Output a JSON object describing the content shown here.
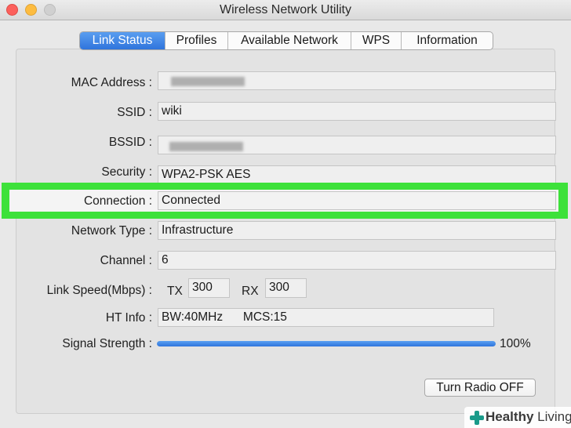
{
  "window": {
    "title": "Wireless Network Utility"
  },
  "tabs": [
    {
      "label": "Link Status",
      "active": true
    },
    {
      "label": "Profiles",
      "active": false
    },
    {
      "label": "Available Network",
      "active": false
    },
    {
      "label": "WPS",
      "active": false
    },
    {
      "label": "Information",
      "active": false
    }
  ],
  "fields": {
    "mac_address": {
      "label": "MAC Address :",
      "value": ""
    },
    "ssid": {
      "label": "SSID :",
      "value": "wiki"
    },
    "bssid": {
      "label": "BSSID :",
      "value": ""
    },
    "security": {
      "label": "Security :",
      "value": "WPA2-PSK AES"
    },
    "connection": {
      "label": "Connection :",
      "value": "Connected"
    },
    "network_type": {
      "label": "Network Type :",
      "value": "Infrastructure"
    },
    "channel": {
      "label": "Channel :",
      "value": "6"
    },
    "link_speed": {
      "label": "Link Speed(Mbps) :",
      "tx_label": "TX",
      "tx_value": "300",
      "rx_label": "RX",
      "rx_value": "300"
    },
    "ht_info": {
      "label": "HT Info :",
      "value": "BW:40MHz      MCS:15"
    },
    "signal_strength": {
      "label": "Signal Strength :",
      "value": "100%",
      "percent": 100
    }
  },
  "buttons": {
    "turn_radio_off": "Turn Radio OFF"
  },
  "highlight_color": "#3de13a",
  "accent_color": "#2f74dc",
  "watermark": {
    "bold": "Healthy",
    "light": " Living"
  }
}
